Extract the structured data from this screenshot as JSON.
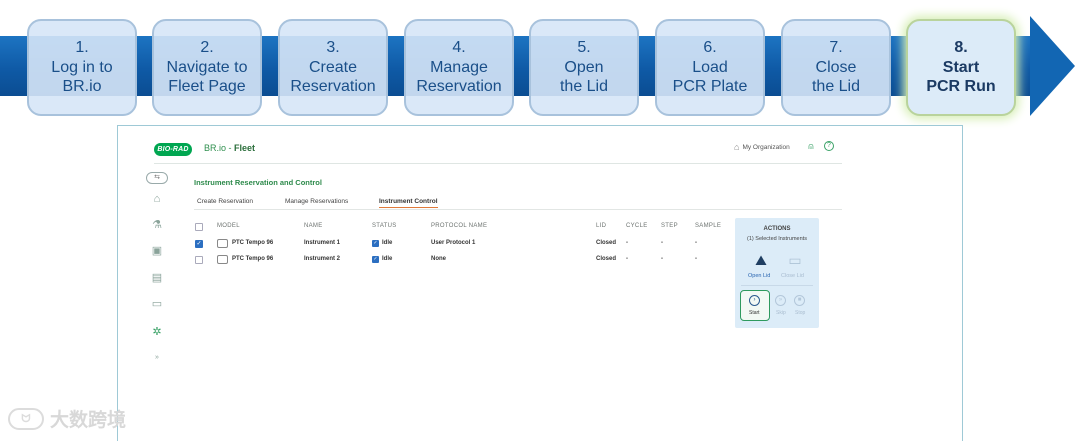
{
  "steps": [
    {
      "number": "1.",
      "line1": "Log in to",
      "line2": "BR.io"
    },
    {
      "number": "2.",
      "line1": "Navigate to",
      "line2": "Fleet Page"
    },
    {
      "number": "3.",
      "line1": "Create",
      "line2": "Reservation"
    },
    {
      "number": "4.",
      "line1": "Manage",
      "line2": "Reservation"
    },
    {
      "number": "5.",
      "line1": "Open",
      "line2": "the Lid"
    },
    {
      "number": "6.",
      "line1": "Load",
      "line2": "PCR Plate"
    },
    {
      "number": "7.",
      "line1": "Close",
      "line2": "the Lid"
    },
    {
      "number": "8.",
      "line1": "Start",
      "line2": "PCR Run"
    }
  ],
  "app": {
    "logo": "BIO-RAD",
    "title_prefix": "BR.io - ",
    "title_page": "Fleet",
    "org_label": "My Organization"
  },
  "page": {
    "section_title": "Instrument Reservation and Control",
    "tabs": [
      "Create Reservation",
      "Manage Reservations",
      "Instrument Control"
    ]
  },
  "table": {
    "headers": [
      "MODEL",
      "NAME",
      "STATUS",
      "PROTOCOL NAME",
      "LID",
      "CYCLE",
      "STEP",
      "SAMPLE"
    ],
    "rows": [
      {
        "model": "PTC Tempo 96",
        "name": "Instrument 1",
        "status": "Idle",
        "protocol": "User Protocol 1",
        "lid": "Closed",
        "cycle": "-",
        "step": "-",
        "sample": "-",
        "selected": true
      },
      {
        "model": "PTC Tempo 96",
        "name": "Instrument 2",
        "status": "Idle",
        "protocol": "None",
        "lid": "Closed",
        "cycle": "-",
        "step": "-",
        "sample": "-",
        "selected": false
      }
    ]
  },
  "actions": {
    "title": "ACTIONS",
    "subtitle": "(1) Selected Instruments",
    "open_lid": "Open Lid",
    "close_lid": "Close Lid",
    "start": "Start",
    "skip": "Skip",
    "stop": "Stop"
  },
  "watermark": "大数跨境"
}
